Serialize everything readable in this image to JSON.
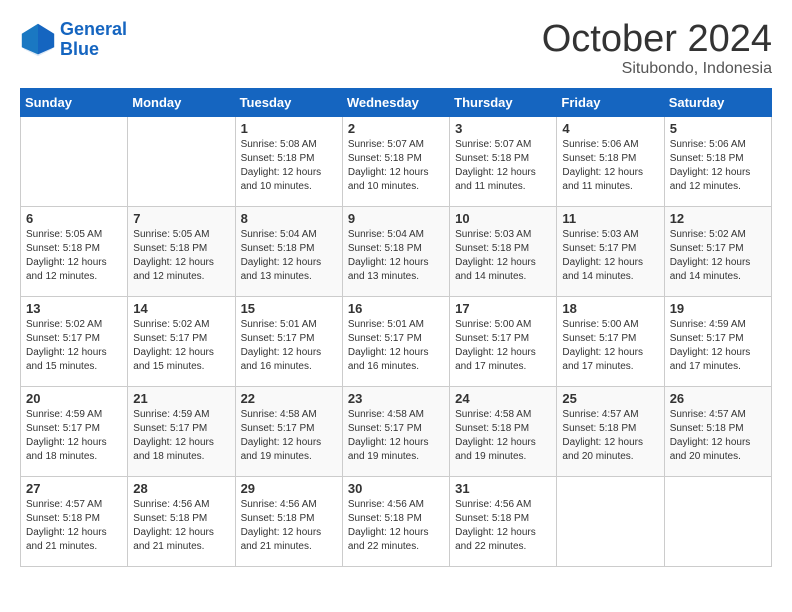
{
  "header": {
    "logo_line1": "General",
    "logo_line2": "Blue",
    "month": "October 2024",
    "location": "Situbondo, Indonesia"
  },
  "weekdays": [
    "Sunday",
    "Monday",
    "Tuesday",
    "Wednesday",
    "Thursday",
    "Friday",
    "Saturday"
  ],
  "weeks": [
    [
      {
        "day": "",
        "info": ""
      },
      {
        "day": "",
        "info": ""
      },
      {
        "day": "1",
        "info": "Sunrise: 5:08 AM\nSunset: 5:18 PM\nDaylight: 12 hours\nand 10 minutes."
      },
      {
        "day": "2",
        "info": "Sunrise: 5:07 AM\nSunset: 5:18 PM\nDaylight: 12 hours\nand 10 minutes."
      },
      {
        "day": "3",
        "info": "Sunrise: 5:07 AM\nSunset: 5:18 PM\nDaylight: 12 hours\nand 11 minutes."
      },
      {
        "day": "4",
        "info": "Sunrise: 5:06 AM\nSunset: 5:18 PM\nDaylight: 12 hours\nand 11 minutes."
      },
      {
        "day": "5",
        "info": "Sunrise: 5:06 AM\nSunset: 5:18 PM\nDaylight: 12 hours\nand 12 minutes."
      }
    ],
    [
      {
        "day": "6",
        "info": "Sunrise: 5:05 AM\nSunset: 5:18 PM\nDaylight: 12 hours\nand 12 minutes."
      },
      {
        "day": "7",
        "info": "Sunrise: 5:05 AM\nSunset: 5:18 PM\nDaylight: 12 hours\nand 12 minutes."
      },
      {
        "day": "8",
        "info": "Sunrise: 5:04 AM\nSunset: 5:18 PM\nDaylight: 12 hours\nand 13 minutes."
      },
      {
        "day": "9",
        "info": "Sunrise: 5:04 AM\nSunset: 5:18 PM\nDaylight: 12 hours\nand 13 minutes."
      },
      {
        "day": "10",
        "info": "Sunrise: 5:03 AM\nSunset: 5:18 PM\nDaylight: 12 hours\nand 14 minutes."
      },
      {
        "day": "11",
        "info": "Sunrise: 5:03 AM\nSunset: 5:17 PM\nDaylight: 12 hours\nand 14 minutes."
      },
      {
        "day": "12",
        "info": "Sunrise: 5:02 AM\nSunset: 5:17 PM\nDaylight: 12 hours\nand 14 minutes."
      }
    ],
    [
      {
        "day": "13",
        "info": "Sunrise: 5:02 AM\nSunset: 5:17 PM\nDaylight: 12 hours\nand 15 minutes."
      },
      {
        "day": "14",
        "info": "Sunrise: 5:02 AM\nSunset: 5:17 PM\nDaylight: 12 hours\nand 15 minutes."
      },
      {
        "day": "15",
        "info": "Sunrise: 5:01 AM\nSunset: 5:17 PM\nDaylight: 12 hours\nand 16 minutes."
      },
      {
        "day": "16",
        "info": "Sunrise: 5:01 AM\nSunset: 5:17 PM\nDaylight: 12 hours\nand 16 minutes."
      },
      {
        "day": "17",
        "info": "Sunrise: 5:00 AM\nSunset: 5:17 PM\nDaylight: 12 hours\nand 17 minutes."
      },
      {
        "day": "18",
        "info": "Sunrise: 5:00 AM\nSunset: 5:17 PM\nDaylight: 12 hours\nand 17 minutes."
      },
      {
        "day": "19",
        "info": "Sunrise: 4:59 AM\nSunset: 5:17 PM\nDaylight: 12 hours\nand 17 minutes."
      }
    ],
    [
      {
        "day": "20",
        "info": "Sunrise: 4:59 AM\nSunset: 5:17 PM\nDaylight: 12 hours\nand 18 minutes."
      },
      {
        "day": "21",
        "info": "Sunrise: 4:59 AM\nSunset: 5:17 PM\nDaylight: 12 hours\nand 18 minutes."
      },
      {
        "day": "22",
        "info": "Sunrise: 4:58 AM\nSunset: 5:17 PM\nDaylight: 12 hours\nand 19 minutes."
      },
      {
        "day": "23",
        "info": "Sunrise: 4:58 AM\nSunset: 5:17 PM\nDaylight: 12 hours\nand 19 minutes."
      },
      {
        "day": "24",
        "info": "Sunrise: 4:58 AM\nSunset: 5:18 PM\nDaylight: 12 hours\nand 19 minutes."
      },
      {
        "day": "25",
        "info": "Sunrise: 4:57 AM\nSunset: 5:18 PM\nDaylight: 12 hours\nand 20 minutes."
      },
      {
        "day": "26",
        "info": "Sunrise: 4:57 AM\nSunset: 5:18 PM\nDaylight: 12 hours\nand 20 minutes."
      }
    ],
    [
      {
        "day": "27",
        "info": "Sunrise: 4:57 AM\nSunset: 5:18 PM\nDaylight: 12 hours\nand 21 minutes."
      },
      {
        "day": "28",
        "info": "Sunrise: 4:56 AM\nSunset: 5:18 PM\nDaylight: 12 hours\nand 21 minutes."
      },
      {
        "day": "29",
        "info": "Sunrise: 4:56 AM\nSunset: 5:18 PM\nDaylight: 12 hours\nand 21 minutes."
      },
      {
        "day": "30",
        "info": "Sunrise: 4:56 AM\nSunset: 5:18 PM\nDaylight: 12 hours\nand 22 minutes."
      },
      {
        "day": "31",
        "info": "Sunrise: 4:56 AM\nSunset: 5:18 PM\nDaylight: 12 hours\nand 22 minutes."
      },
      {
        "day": "",
        "info": ""
      },
      {
        "day": "",
        "info": ""
      }
    ]
  ]
}
